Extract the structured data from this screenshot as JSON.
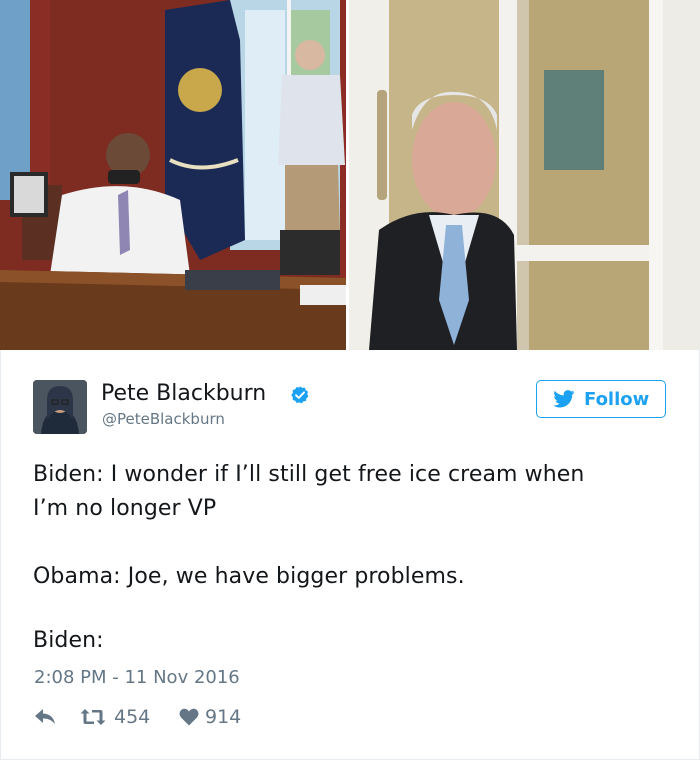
{
  "tweet": {
    "author_name": "Pete Blackburn",
    "author_handle": "@PeteBlackburn",
    "follow_label": "Follow",
    "lines": [
      "Biden: I wonder if I’ll still get free ice cream when",
      "I’m no longer VP",
      "Obama: Joe, we have bigger problems.",
      "Biden:"
    ],
    "timestamp": "2:08 PM - 11 Nov 2016",
    "retweets": "454",
    "likes": "914"
  },
  "colors": {
    "twitter_blue": "#1da1f2",
    "text": "#14171a",
    "muted": "#657786"
  },
  "icons": [
    "verified-badge-icon",
    "twitter-bird-icon",
    "reply-icon",
    "retweet-icon",
    "heart-icon"
  ]
}
